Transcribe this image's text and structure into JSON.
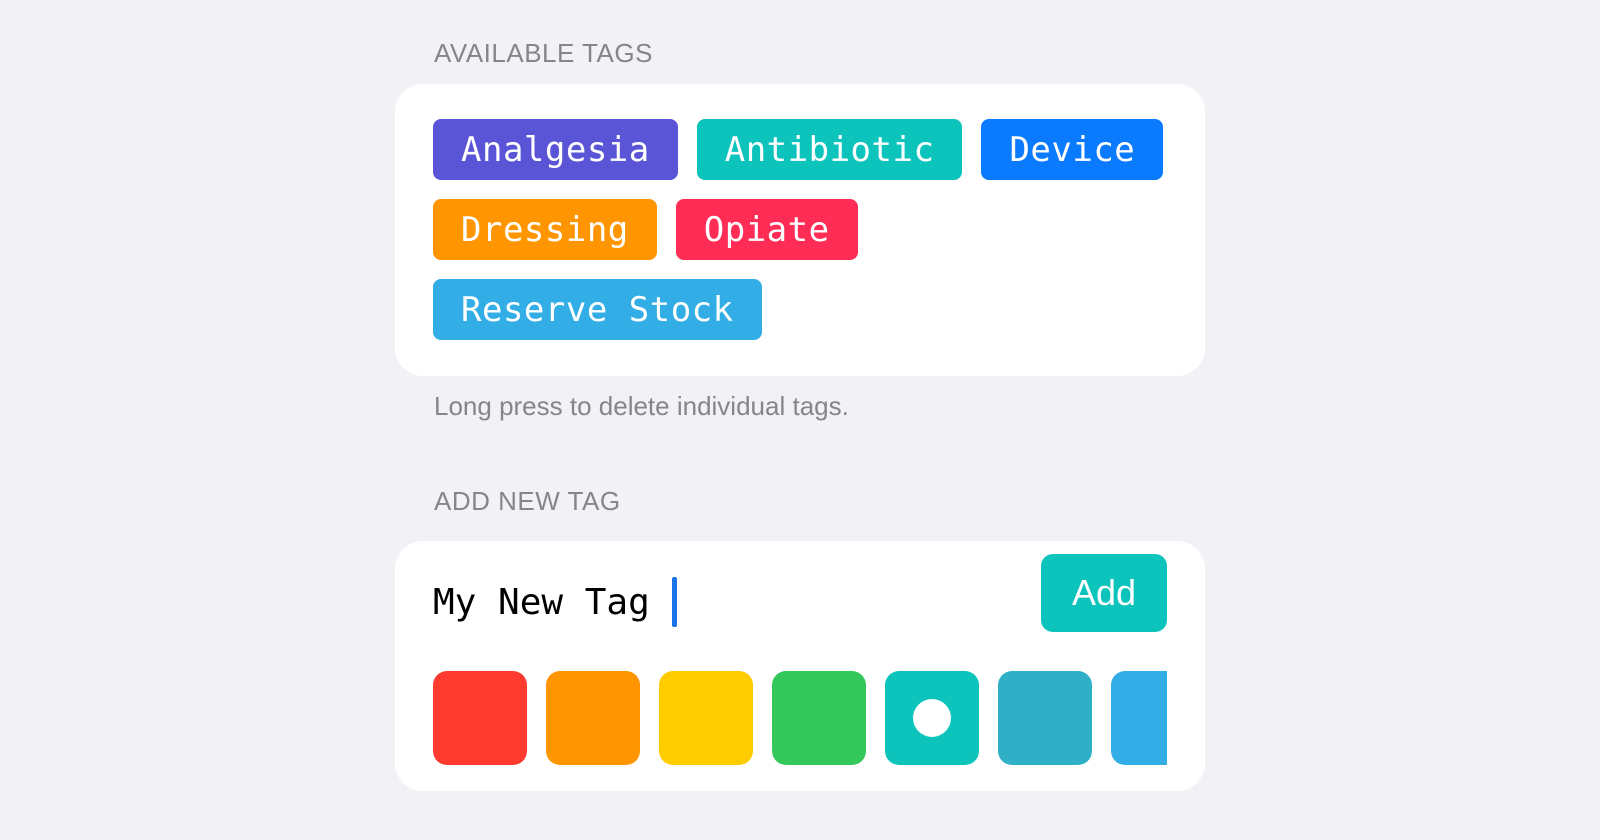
{
  "available_tags": {
    "header": "AVAILABLE TAGS",
    "tags": [
      {
        "label": "Analgesia",
        "color": "#5a55d6"
      },
      {
        "label": "Antibiotic",
        "color": "#0cc4bb"
      },
      {
        "label": "Device",
        "color": "#0a7aff"
      },
      {
        "label": "Dressing",
        "color": "#ff9500"
      },
      {
        "label": "Opiate",
        "color": "#ff2d55"
      },
      {
        "label": "Reserve Stock",
        "color": "#32ade6"
      }
    ],
    "footer": "Long press to delete individual tags."
  },
  "add_new_tag": {
    "header": "ADD NEW TAG",
    "input_value": "My New Tag",
    "add_button_label": "Add",
    "add_button_color": "#0cc4bb",
    "colors": [
      {
        "name": "red",
        "hex": "#ff3b30",
        "selected": false
      },
      {
        "name": "orange",
        "hex": "#ff9500",
        "selected": false
      },
      {
        "name": "yellow",
        "hex": "#ffcc00",
        "selected": false
      },
      {
        "name": "green",
        "hex": "#34c759",
        "selected": false
      },
      {
        "name": "mint",
        "hex": "#0cc4bb",
        "selected": true
      },
      {
        "name": "teal",
        "hex": "#30b0c7",
        "selected": false
      },
      {
        "name": "cyan",
        "hex": "#32ade6",
        "selected": false
      }
    ]
  }
}
